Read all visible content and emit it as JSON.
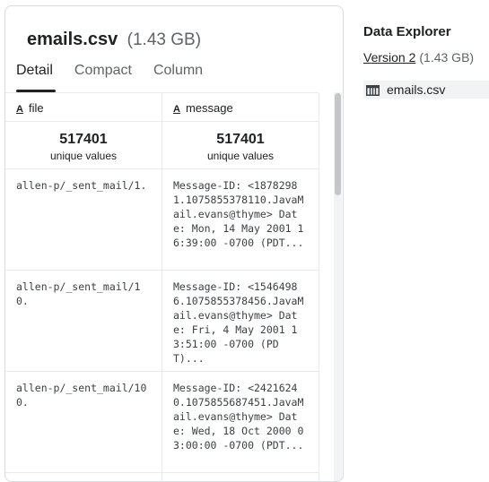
{
  "file": {
    "name": "emails.csv",
    "size": "(1.43 GB)"
  },
  "tabs": [
    {
      "label": "Detail"
    },
    {
      "label": "Compact"
    },
    {
      "label": "Column"
    }
  ],
  "columns": [
    {
      "type_icon": "A",
      "name": "file",
      "unique_count": "517401",
      "unique_label": "unique values"
    },
    {
      "type_icon": "A",
      "name": "message",
      "unique_count": "517401",
      "unique_label": "unique values"
    }
  ],
  "rows": [
    {
      "file": "allen-p/_sent_mail/1.",
      "message": "Message-ID: <18782981.1075855378110.JavaMail.evans@thyme> Date: Mon, 14 May 2001 16:39:00 -0700 (PDT..."
    },
    {
      "file": "allen-p/_sent_mail/10.",
      "message": "Message-ID: <15464986.1075855378456.JavaMail.evans@thyme> Date: Fri, 4 May 2001 13:51:00 -0700 (PDT)..."
    },
    {
      "file": "allen-p/_sent_mail/100.",
      "message": "Message-ID: <24216240.1075855687451.JavaMail.evans@thyme> Date: Wed, 18 Oct 2000 03:00:00 -0700 (PDT..."
    }
  ],
  "sidebar": {
    "title": "Data Explorer",
    "version_label": "Version 2",
    "version_size": "(1.43 GB)",
    "files": [
      {
        "name": "emails.csv",
        "icon": "table-icon"
      }
    ]
  }
}
